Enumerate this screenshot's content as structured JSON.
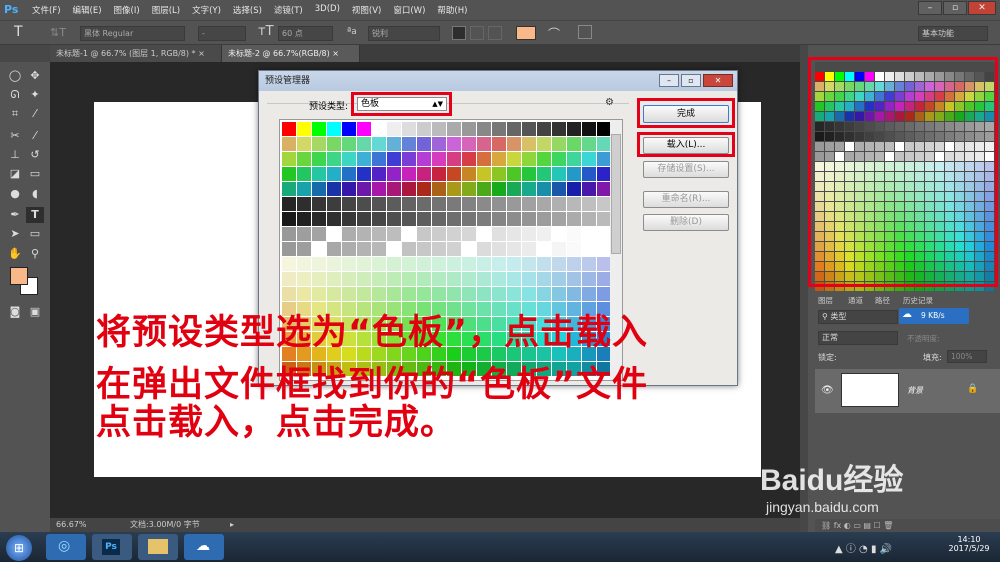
{
  "app": {
    "logo": "Ps"
  },
  "menu": [
    "文件(F)",
    "编辑(E)",
    "图像(I)",
    "图层(L)",
    "文字(Y)",
    "选择(S)",
    "滤镜(T)",
    "3D(D)",
    "视图(V)",
    "窗口(W)",
    "帮助(H)"
  ],
  "options": {
    "font_family": "黑体",
    "font_style": "Regular",
    "font_size": "60 点",
    "aa_label": "ªa",
    "anti_alias": "锐利",
    "workspace": "基本功能",
    "text_color": "#f8b88a"
  },
  "tabs": [
    "未标题-1 @ 66.7% (图层 1, RGB/8) *",
    "未标题-2 @ 66.7%(RGB/8)"
  ],
  "status": {
    "zoom": "66.67%",
    "doc": "文档:3.00M/0 字节"
  },
  "dialog": {
    "title": "预设管理器",
    "preset_type_label": "预设类型:",
    "preset_type_value": "色板",
    "buttons": {
      "done": "完成",
      "load": "载入(L)...",
      "save": "存储设置(S)...",
      "rename": "重命名(R)...",
      "delete": "删除(D)"
    }
  },
  "layers": {
    "tabs": [
      "图层",
      "通道",
      "路径",
      "历史记录"
    ],
    "kind": "类型",
    "blend": "正常",
    "opacity_label": "不透明度:",
    "lock_label": "锁定:",
    "fill_label": "填充:",
    "fill_value": "100%",
    "layer_name": "背景",
    "net_speed": "9 KB/s"
  },
  "instruction": {
    "line1": "将预设类型选为“色板”，点击载入",
    "line2": "在弹出文件框找到你的“色板”文件",
    "line3": "点击载入，点击完成。"
  },
  "taskbar": {
    "time": "14:10",
    "date": "2017/5/29"
  },
  "watermark": {
    "brand": "Baidu经验",
    "url": "jingyan.baidu.com"
  }
}
